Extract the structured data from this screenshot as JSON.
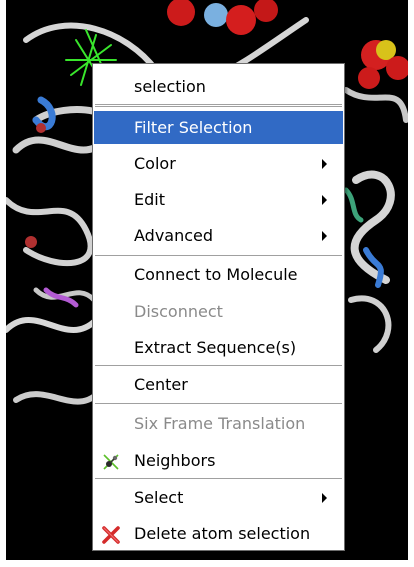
{
  "context_menu": {
    "header": "selection",
    "items": [
      {
        "label": "Filter Selection",
        "state": "highlighted"
      },
      {
        "label": "Color",
        "submenu": true
      },
      {
        "label": "Edit",
        "submenu": true
      },
      {
        "label": "Advanced",
        "submenu": true
      },
      {
        "label": "Connect to Molecule"
      },
      {
        "label": "Disconnect",
        "state": "disabled"
      },
      {
        "label": "Extract Sequence(s)"
      },
      {
        "label": "Center"
      },
      {
        "label": "Six Frame Translation",
        "state": "disabled"
      },
      {
        "label": "Neighbors",
        "icon": "neighbors-icon"
      },
      {
        "label": "Select",
        "submenu": true
      },
      {
        "label": "Delete atom selection",
        "icon": "delete-x-icon"
      }
    ]
  },
  "colors": {
    "highlight": "#316ac5",
    "disabled_text": "#8a8a8a",
    "viewer_background": "#000000",
    "ribbon": "#d8d8d8",
    "selection_green": "#39e62c"
  }
}
